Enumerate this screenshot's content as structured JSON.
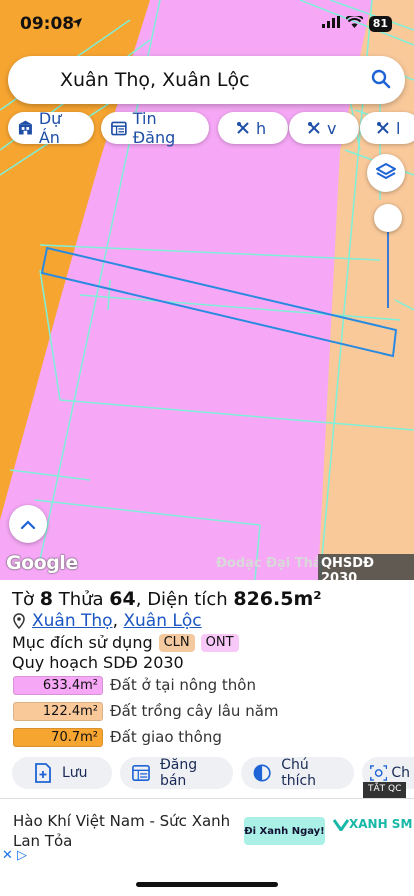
{
  "status_bar": {
    "time": "09:08",
    "battery": "81"
  },
  "search": {
    "query": "Xuân Thọ, Xuân Lộc"
  },
  "filters": [
    {
      "label": "Dự Án"
    },
    {
      "label": "Tin Đăng"
    },
    {
      "label": "h"
    },
    {
      "label": "v"
    },
    {
      "label": "l"
    }
  ],
  "map": {
    "attribution": "Google",
    "watermark": "Đodạc Đại Thắn",
    "layer_badge": "QHSDĐ 2030",
    "colors": {
      "residential": "#f6a8f6",
      "perennial": "#f9c99a",
      "traffic": "#f7a531",
      "lines": "#7ff0d8",
      "parcel": "#2a8ae0"
    }
  },
  "parcel": {
    "sheet_label": "Tờ",
    "sheet": "8",
    "lot_label": "Thửa",
    "lot": "64",
    "area_label": ", Diện tích",
    "area": "826.5m²",
    "commune": "Xuân Thọ",
    "district": "Xuân Lộc",
    "purpose_label": "Mục đích sử dụng",
    "purpose_tags": [
      "CLN",
      "ONT"
    ],
    "plan_label": "Quy hoạch SDĐ 2030",
    "plan_items": [
      {
        "area": "633.4m²",
        "label": "Đất ở tại nông thôn",
        "color": "#f6a8f6"
      },
      {
        "area": "122.4m²",
        "label": "Đất trồng cây lâu năm",
        "color": "#f9c99a"
      },
      {
        "area": "70.7m²",
        "label": "Đất giao thông",
        "color": "#f7a531"
      }
    ]
  },
  "actions": [
    {
      "label": "Lưu"
    },
    {
      "label": "Đăng bán"
    },
    {
      "label": "Chú thích"
    },
    {
      "label": "Ch"
    }
  ],
  "ad": {
    "close_label": "TẮT QC",
    "headline": "Hào Khí Việt Nam - Sức Xanh Lan Tỏa",
    "cta": "Đi Xanh Ngay!",
    "brand": "XANH SM"
  }
}
